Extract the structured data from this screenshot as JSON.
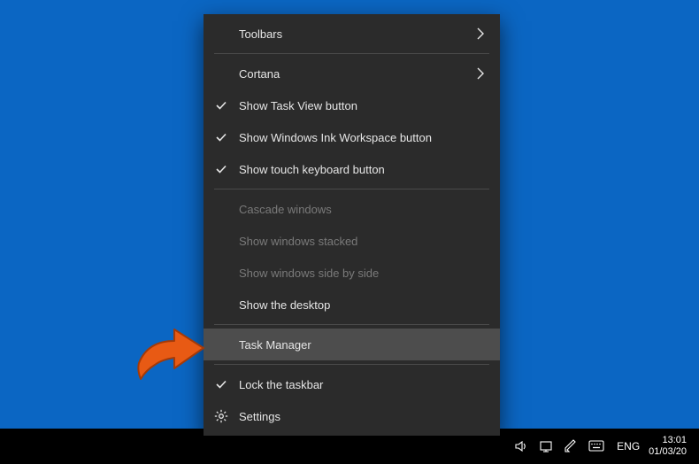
{
  "menu": {
    "toolbars": "Toolbars",
    "cortana": "Cortana",
    "show_task_view": "Show Task View button",
    "show_ink_workspace": "Show Windows Ink Workspace button",
    "show_touch_keyboard": "Show touch keyboard button",
    "cascade_windows": "Cascade windows",
    "show_windows_stacked": "Show windows stacked",
    "show_windows_side_by_side": "Show windows side by side",
    "show_the_desktop": "Show the desktop",
    "task_manager": "Task Manager",
    "lock_the_taskbar": "Lock the taskbar",
    "settings": "Settings"
  },
  "tray": {
    "lang": "ENG",
    "time": "13:01",
    "date": "01/03/20"
  }
}
